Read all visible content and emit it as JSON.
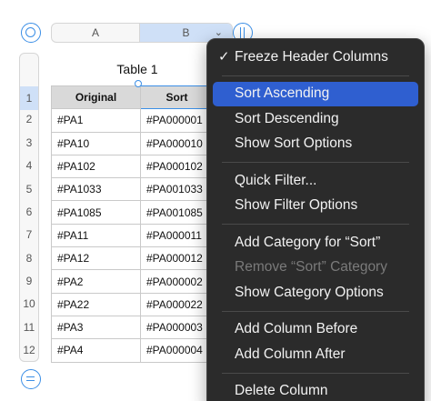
{
  "columns": {
    "a": "A",
    "b": "B"
  },
  "rows": [
    "1",
    "2",
    "3",
    "4",
    "5",
    "6",
    "7",
    "8",
    "9",
    "10",
    "11",
    "12"
  ],
  "table": {
    "title": "Table 1",
    "headers": [
      "Original",
      "Sort"
    ],
    "cells": [
      [
        "#PA1",
        "#PA000001"
      ],
      [
        "#PA10",
        "#PA000010"
      ],
      [
        "#PA102",
        "#PA000102"
      ],
      [
        "#PA1033",
        "#PA001033"
      ],
      [
        "#PA1085",
        "#PA001085"
      ],
      [
        "#PA11",
        "#PA000011"
      ],
      [
        "#PA12",
        "#PA000012"
      ],
      [
        "#PA2",
        "#PA000002"
      ],
      [
        "#PA22",
        "#PA000022"
      ],
      [
        "#PA3",
        "#PA000003"
      ],
      [
        "#PA4",
        "#PA000004"
      ]
    ]
  },
  "menu": {
    "freeze": "Freeze Header Columns",
    "sort_asc": "Sort Ascending",
    "sort_desc": "Sort Descending",
    "show_sort": "Show Sort Options",
    "quick_filter": "Quick Filter...",
    "show_filter": "Show Filter Options",
    "add_category": "Add Category for “Sort”",
    "remove_category": "Remove “Sort” Category",
    "show_category": "Show Category Options",
    "add_before": "Add Column Before",
    "add_after": "Add Column After",
    "delete_column": "Delete Column"
  },
  "colors": {
    "accent": "#3a8ee6",
    "menu_bg": "#2b2b2b",
    "menu_highlight": "#2f5fd0",
    "selection": "#cfe0f7"
  }
}
